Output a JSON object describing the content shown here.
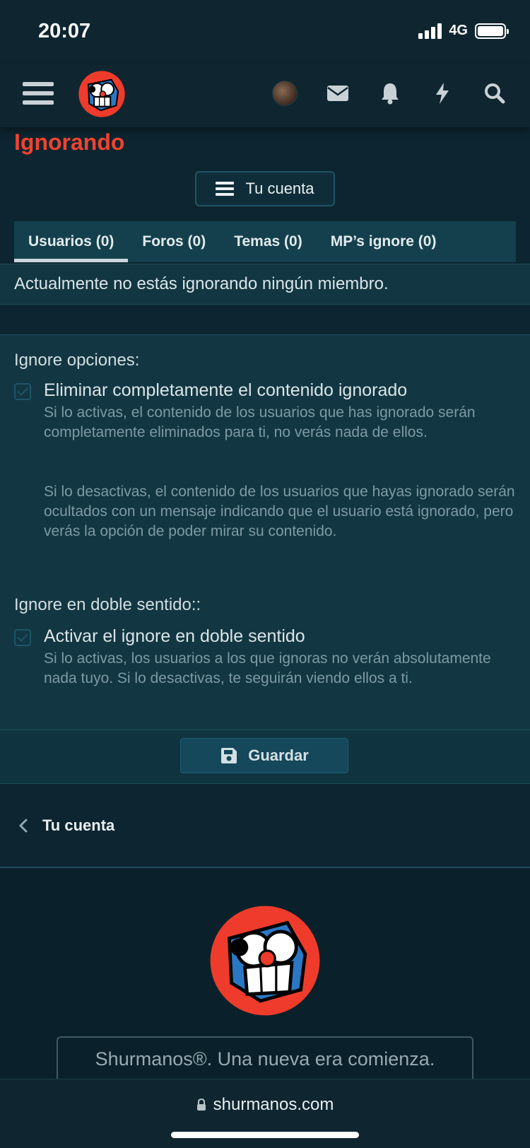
{
  "status_bar": {
    "time": "20:07",
    "network": "4G",
    "battery_level": 1.0
  },
  "navbar": {
    "icons": [
      "menu-icon",
      "site-logo",
      "avatar",
      "envelope-icon",
      "bell-icon",
      "bolt-icon",
      "search-icon"
    ]
  },
  "page": {
    "title": "Ignorando",
    "account_button": "Tu cuenta"
  },
  "tabs": [
    {
      "label": "Usuarios (0)",
      "active": true
    },
    {
      "label": "Foros (0)",
      "active": false
    },
    {
      "label": "Temas (0)",
      "active": false
    },
    {
      "label": "MP’s ignore (0)",
      "active": false
    }
  ],
  "notice": "Actualmente no estás ignorando ningún miembro.",
  "options": {
    "ignore_heading": "Ignore opciones:",
    "ignore_option": {
      "label": "Eliminar completamente el contenido ignorado",
      "checked": true,
      "desc_1": "Si lo activas, el contenido de los usuarios que has ignorado serán completamente eliminados para ti, no verás nada de ellos.",
      "desc_2": "Si lo desactivas, el contenido de los usuarios que hayas ignorado serán ocultados con un mensaje indicando que el usuario está ignorado, pero verás la opción de poder mirar su contenido."
    },
    "double_heading": "Ignore en doble sentido::",
    "double_option": {
      "label": "Activar el ignore en doble sentido",
      "checked": true,
      "desc": "Si lo activas, los usuarios a los que ignoras no verán absolutamente nada tuyo. Si lo desactivas, te seguirán viendo ellos a ti."
    }
  },
  "save_button": "Guardar",
  "breadcrumb": "Tu cuenta",
  "footer": {
    "slogan": "Shurmanos®. Una nueva era comienza."
  },
  "browser": {
    "url": "shurmanos.com"
  },
  "colors": {
    "accent_red": "#f0432f",
    "background": "#0d2530",
    "panel": "#123742"
  }
}
